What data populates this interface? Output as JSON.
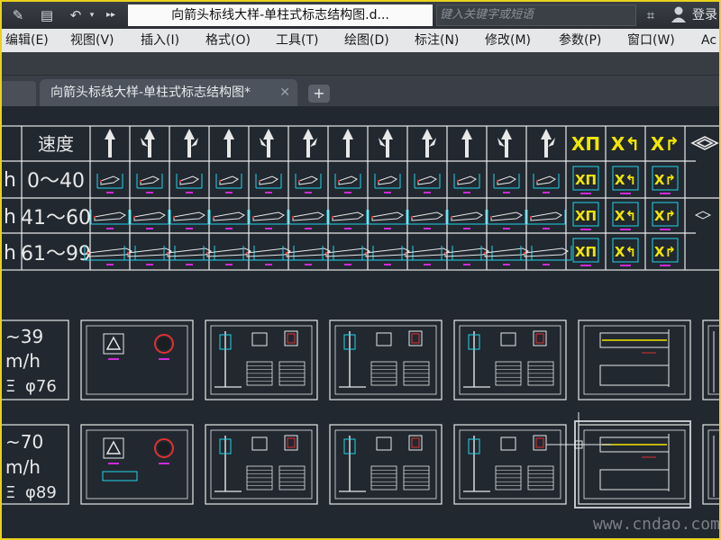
{
  "titlebar": {
    "title": "向箭头标线大样-单柱式标志结构图.d...",
    "search_placeholder": "键入关键字或短语",
    "login_label": "登录"
  },
  "menu": [
    {
      "label": "编辑(E)"
    },
    {
      "label": "视图(V)"
    },
    {
      "label": "插入(I)"
    },
    {
      "label": "格式(O)"
    },
    {
      "label": "工具(T)"
    },
    {
      "label": "绘图(D)"
    },
    {
      "label": "标注(N)"
    },
    {
      "label": "修改(M)"
    },
    {
      "label": "参数(P)"
    },
    {
      "label": "窗口(W)"
    },
    {
      "label": "Ac"
    }
  ],
  "tabs": {
    "active_label": "向箭头标线大样-单柱式标志结构图*",
    "close_glyph": "✕",
    "add_glyph": "+"
  },
  "table": {
    "header_speed": "速度",
    "row_left_fragment": "h",
    "rows": [
      {
        "speed": "0～40"
      },
      {
        "speed": "41～60"
      },
      {
        "speed": "61～99"
      }
    ],
    "arrow_icons": [
      "straight-arrow-icon",
      "straight-left-arrow-icon",
      "straight-right-arrow-icon",
      "left-right-arrow-icon",
      "right-turn-arrow-icon",
      "left-turn-arrow-icon",
      "u-turn-arrow-icon",
      "left-straight-arrow-icon",
      "right-straight-arrow-icon",
      "fork-arrow-icon",
      "bear-left-arrow-icon",
      "bear-right-arrow-icon",
      "merge-left-yellow-icon",
      "merge-right-yellow-icon",
      "merge-split-yellow-icon",
      "diamond-icon"
    ]
  },
  "blocks": [
    {
      "lines": [
        "~39",
        "m/h",
        "φ76"
      ]
    },
    {
      "lines": [
        "~70",
        "m/h",
        "φ89"
      ]
    }
  ],
  "watermark": "www.cndao.com",
  "colors": {
    "frame_border": "#e9d21a",
    "canvas_bg": "#212830",
    "line_white": "#e8e8e8",
    "yellow": "#f2e600",
    "cyan": "#22d3e8",
    "magenta": "#d02ad8",
    "red": "#e03030"
  }
}
